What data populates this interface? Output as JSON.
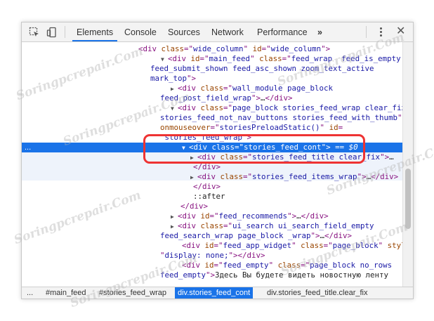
{
  "toolbar": {
    "tabs": [
      "Elements",
      "Console",
      "Sources",
      "Network",
      "Performance"
    ],
    "more": "»",
    "close": "✕"
  },
  "tree": {
    "lines": [
      {
        "i": "0",
        "a": "",
        "parts": [
          [
            "tag",
            "<div "
          ],
          [
            "attr",
            "class"
          ],
          [
            "tag",
            "=\""
          ],
          [
            "val",
            "wide_column"
          ],
          [
            "tag",
            "\" "
          ],
          [
            "attr",
            "id"
          ],
          [
            "tag",
            "=\""
          ],
          [
            "val",
            "wide_column"
          ],
          [
            "tag",
            "\">"
          ]
        ]
      },
      {
        "i": "1",
        "a": "▼",
        "parts": [
          [
            "tag",
            "<div "
          ],
          [
            "attr",
            "id"
          ],
          [
            "tag",
            "=\""
          ],
          [
            "val",
            "main_feed"
          ],
          [
            "tag",
            "\" "
          ],
          [
            "attr",
            "class"
          ],
          [
            "tag",
            "=\""
          ],
          [
            "val",
            "feed_wrap  feed_is_empty"
          ]
        ]
      },
      {
        "i": "1c",
        "a": "",
        "parts": [
          [
            "val",
            "feed_submit_shown feed_asc_shown zoom_text_active"
          ]
        ]
      },
      {
        "i": "1c",
        "a": "",
        "parts": [
          [
            "val",
            "mark_top"
          ],
          [
            "tag",
            "\">"
          ]
        ]
      },
      {
        "i": "2",
        "a": "▶",
        "parts": [
          [
            "tag",
            "<div "
          ],
          [
            "attr",
            "class"
          ],
          [
            "tag",
            "=\""
          ],
          [
            "val",
            "wall_module page_block"
          ]
        ]
      },
      {
        "i": "2c",
        "a": "",
        "parts": [
          [
            "val",
            "feed_post_field_wrap"
          ],
          [
            "tag",
            "\">"
          ],
          [
            "txt",
            "…"
          ],
          [
            "tag",
            "</div>"
          ]
        ]
      },
      {
        "i": "2",
        "a": "▼",
        "parts": [
          [
            "tag",
            "<div "
          ],
          [
            "attr",
            "class"
          ],
          [
            "tag",
            "=\""
          ],
          [
            "val",
            "page_block stories_feed_wrap clear_fix"
          ]
        ]
      },
      {
        "i": "2c",
        "a": "",
        "parts": [
          [
            "val",
            "stories_feed_not_nav_buttons stories_feed_with_thumb"
          ],
          [
            "tag",
            "\""
          ]
        ]
      },
      {
        "i": "2c",
        "a": "",
        "parts": [
          [
            "attr",
            "onmouseover"
          ],
          [
            "tag",
            "=\""
          ],
          [
            "val",
            "storiesPreloadStatic()"
          ],
          [
            "tag",
            "\" "
          ],
          [
            "attr",
            "id"
          ],
          [
            "tag",
            "="
          ]
        ]
      },
      {
        "i": "2c",
        "a": "",
        "parts": [
          [
            "tag",
            "\""
          ],
          [
            "val",
            "stories_feed_wrap"
          ],
          [
            "tag",
            "\">"
          ]
        ]
      },
      {
        "i": "3",
        "a": "▼",
        "sel": true,
        "parts": [
          [
            "tag",
            "<div "
          ],
          [
            "attr",
            "class"
          ],
          [
            "tag",
            "=\""
          ],
          [
            "val",
            "stories_feed_cont"
          ],
          [
            "tag",
            "\">"
          ],
          [
            "txt",
            " == "
          ],
          [
            "dollar",
            "$0"
          ]
        ]
      },
      {
        "i": "4",
        "a": "▶",
        "parts": [
          [
            "tag",
            "<div "
          ],
          [
            "attr",
            "class"
          ],
          [
            "tag",
            "=\""
          ],
          [
            "val",
            "stories_feed_title clear_fix"
          ],
          [
            "tag",
            "\">"
          ],
          [
            "txt",
            "…"
          ]
        ]
      },
      {
        "i": "4c",
        "a": "",
        "parts": [
          [
            "tag",
            "</div>"
          ]
        ]
      },
      {
        "i": "4",
        "a": "▶",
        "parts": [
          [
            "tag",
            "<div "
          ],
          [
            "attr",
            "class"
          ],
          [
            "tag",
            "=\""
          ],
          [
            "val",
            "stories_feed_items_wrap"
          ],
          [
            "tag",
            "\">"
          ],
          [
            "txt",
            "…"
          ],
          [
            "tag",
            "</div>"
          ]
        ]
      },
      {
        "i": "4c",
        "a": "",
        "parts": [
          [
            "tag",
            "</div>"
          ]
        ]
      },
      {
        "i": "4c",
        "a": "",
        "parts": [
          [
            "txt",
            "::after"
          ]
        ]
      },
      {
        "i": "3c",
        "a": "",
        "parts": [
          [
            "tag",
            "</div>"
          ]
        ]
      },
      {
        "i": "2",
        "a": "▶",
        "parts": [
          [
            "tag",
            "<div "
          ],
          [
            "attr",
            "id"
          ],
          [
            "tag",
            "=\""
          ],
          [
            "val",
            "feed_recommends"
          ],
          [
            "tag",
            "\">"
          ],
          [
            "txt",
            "…"
          ],
          [
            "tag",
            "</div>"
          ]
        ]
      },
      {
        "i": "2",
        "a": "▶",
        "parts": [
          [
            "tag",
            "<div "
          ],
          [
            "attr",
            "class"
          ],
          [
            "tag",
            "=\""
          ],
          [
            "val",
            "ui_search ui_search_field_empty"
          ]
        ]
      },
      {
        "i": "2c",
        "a": "",
        "parts": [
          [
            "val",
            "feed_search_wrap page_block _wrap"
          ],
          [
            "tag",
            "\">"
          ],
          [
            "txt",
            "…"
          ],
          [
            "tag",
            "</div>"
          ]
        ]
      },
      {
        "i": "2d",
        "a": "",
        "parts": [
          [
            "tag",
            "<div "
          ],
          [
            "attr",
            "id"
          ],
          [
            "tag",
            "=\""
          ],
          [
            "val",
            "feed_app_widget"
          ],
          [
            "tag",
            "\" "
          ],
          [
            "attr",
            "class"
          ],
          [
            "tag",
            "=\""
          ],
          [
            "val",
            "page_block"
          ],
          [
            "tag",
            "\" "
          ],
          [
            "attr",
            "style"
          ],
          [
            "tag",
            "="
          ]
        ]
      },
      {
        "i": "2c",
        "a": "",
        "parts": [
          [
            "tag",
            "\""
          ],
          [
            "val",
            "display: none;"
          ],
          [
            "tag",
            "\"></div>"
          ]
        ]
      },
      {
        "i": "2d",
        "a": "",
        "parts": [
          [
            "tag",
            "<div "
          ],
          [
            "attr",
            "id"
          ],
          [
            "tag",
            "=\""
          ],
          [
            "val",
            "feed_empty"
          ],
          [
            "tag",
            "\" "
          ],
          [
            "attr",
            "class"
          ],
          [
            "tag",
            "=\""
          ],
          [
            "val",
            "page_block no_rows"
          ]
        ]
      },
      {
        "i": "2c",
        "a": "",
        "parts": [
          [
            "val",
            "feed_empty"
          ],
          [
            "tag",
            "\">"
          ],
          [
            "txt",
            "Здесь Вы будете видеть новостную ленту"
          ]
        ]
      }
    ]
  },
  "breadcrumbs": [
    "...",
    "#main_feed",
    "#stories_feed_wrap",
    "div.stories_feed_cont",
    "div.stories_feed_title.clear_fix"
  ],
  "watermark": "Soringpcrepair.Com",
  "colors": {
    "accent": "#1a73e8",
    "tag": "#881280",
    "attr": "#994500",
    "value": "#1a1aa6",
    "highlight": "#e33333"
  }
}
